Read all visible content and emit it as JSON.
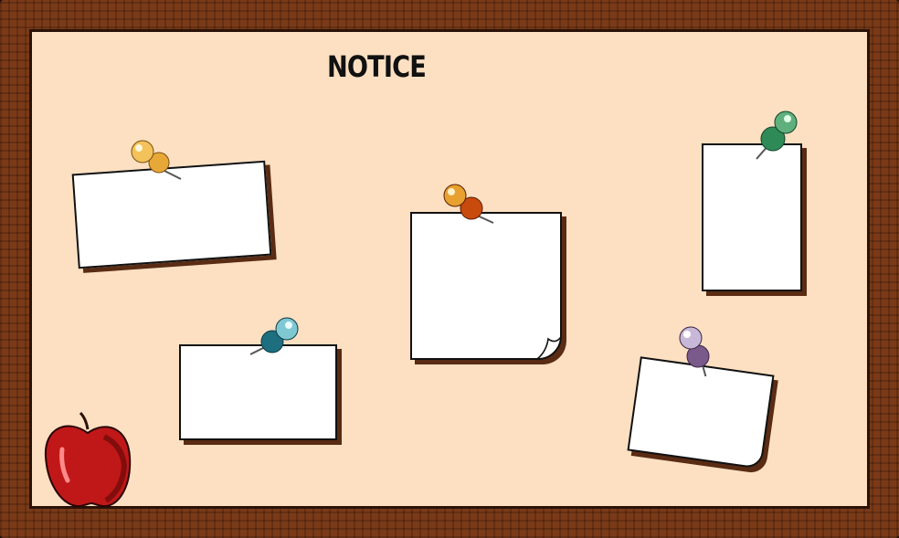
{
  "board": {
    "title": "NOTICE",
    "colors": {
      "cork": "#fde0c2",
      "frame": "#7a3a18",
      "note": "#ffffff"
    },
    "notes": [
      {
        "id": "note-1",
        "pin": "yellow-pushpin-icon",
        "pin_color": "#e8b040"
      },
      {
        "id": "note-2",
        "pin": "teal-pushpin-icon",
        "pin_color": "#1f7a8a"
      },
      {
        "id": "note-3",
        "pin": "orange-pushpin-icon",
        "pin_color": "#d45a10"
      },
      {
        "id": "note-4",
        "pin": "green-pushpin-icon",
        "pin_color": "#2e8b57"
      },
      {
        "id": "note-5",
        "pin": "purple-pushpin-icon",
        "pin_color": "#7a5a8a"
      }
    ],
    "decoration": "apple-icon"
  }
}
